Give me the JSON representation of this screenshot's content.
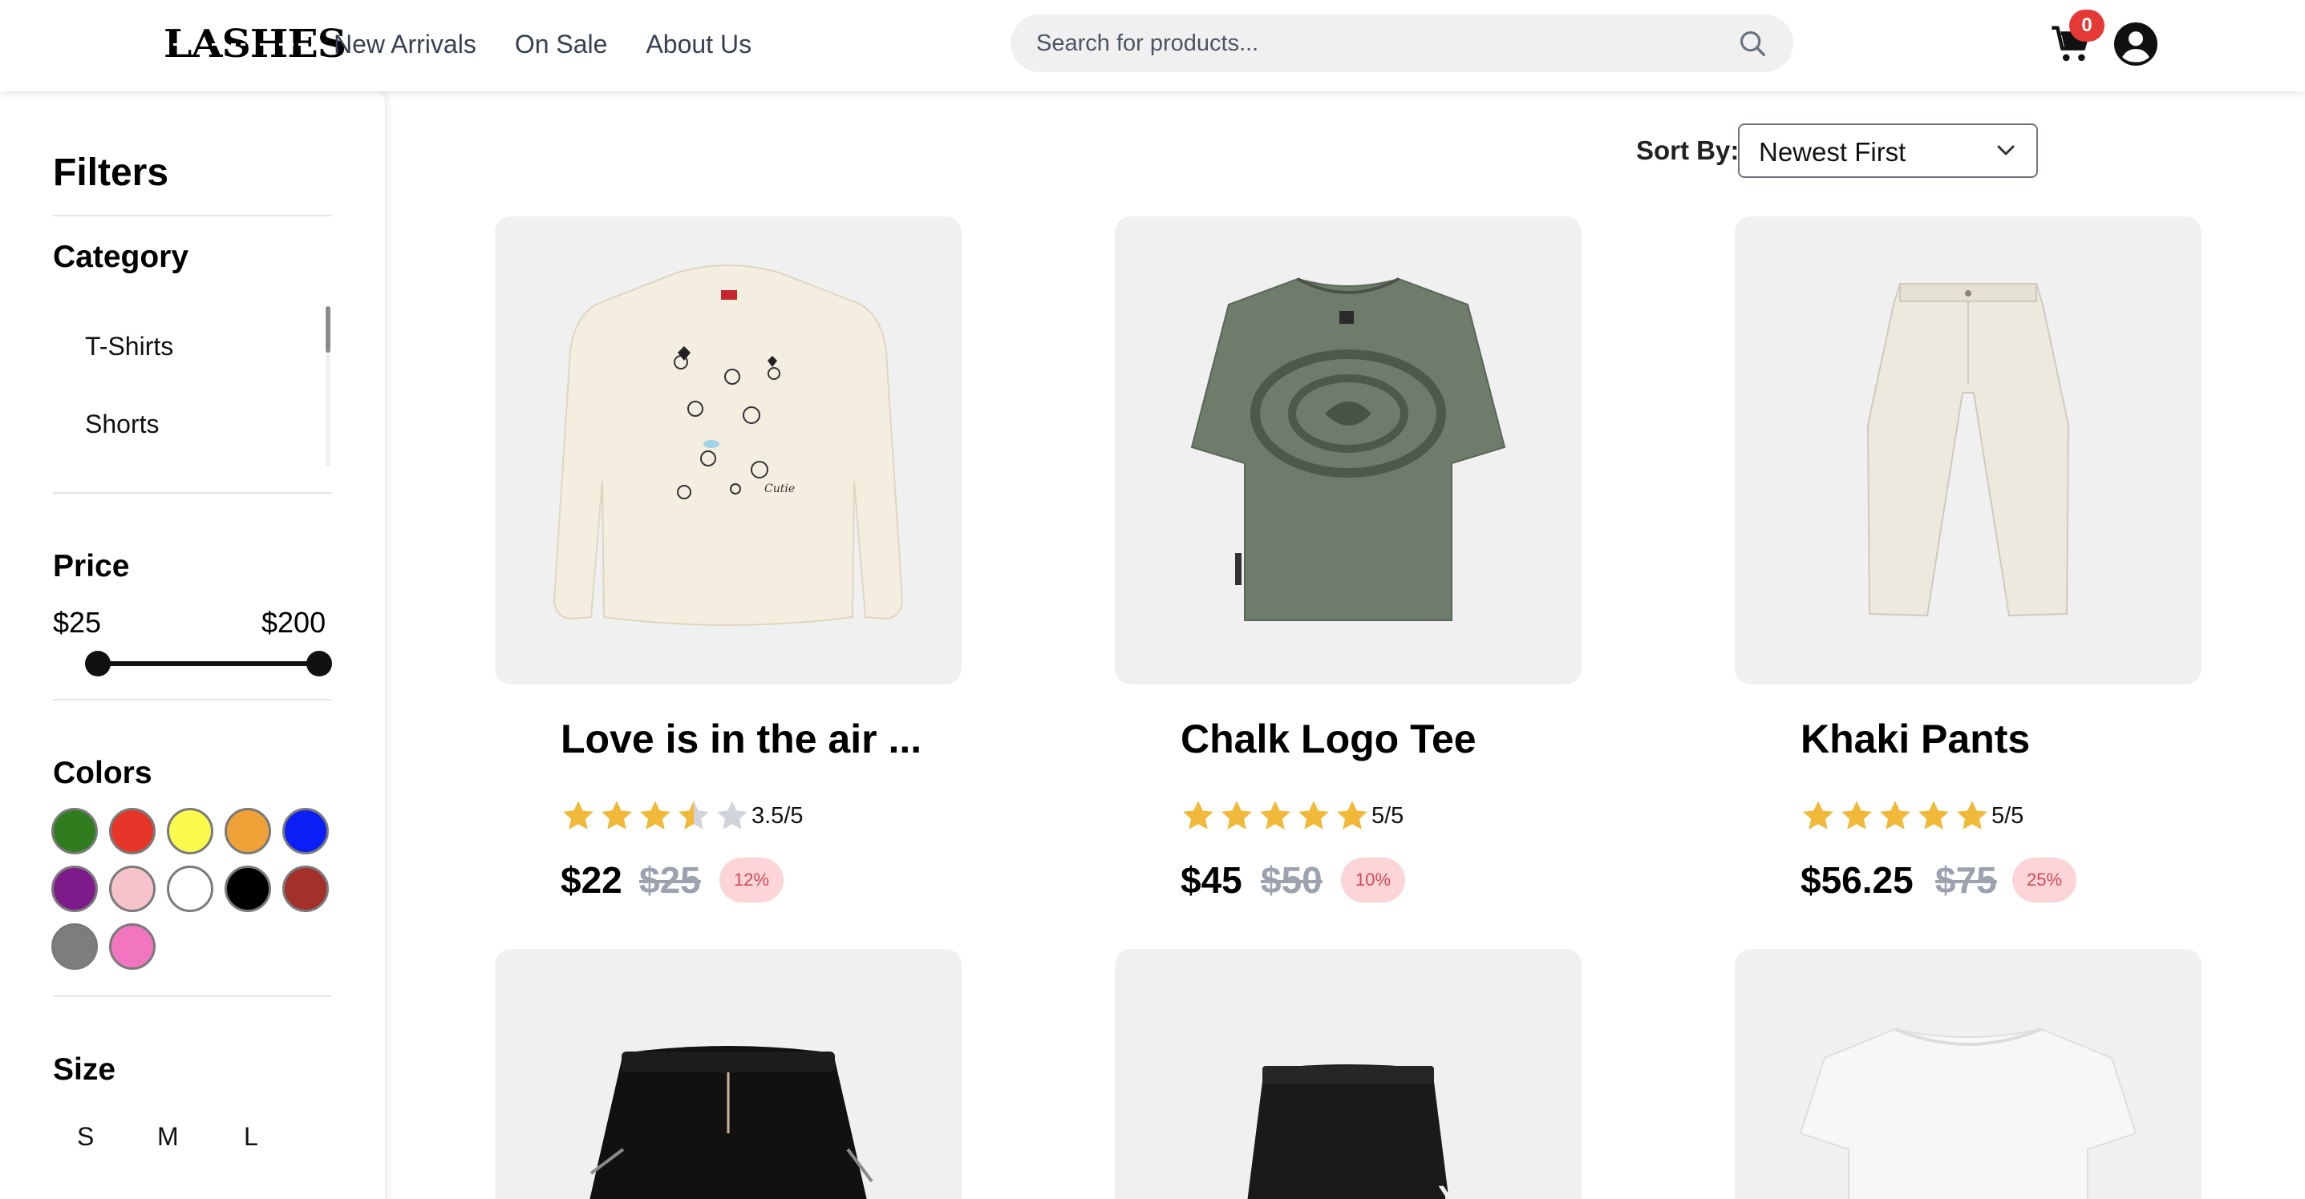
{
  "header": {
    "logo_text": "LASHES",
    "nav": [
      "New Arrivals",
      "On Sale",
      "About Us"
    ],
    "search_placeholder": "Search for products...",
    "cart_count": "0",
    "icons": {
      "search": "search-icon",
      "cart": "cart-icon",
      "user": "user-circle-icon"
    },
    "badge_color": "#e53935"
  },
  "sidebar": {
    "title": "Filters",
    "category_heading": "Category",
    "categories": [
      "T-Shirts",
      "Shorts"
    ],
    "price_heading": "Price",
    "price_min": "$25",
    "price_max": "$200",
    "colors_heading": "Colors",
    "colors": [
      "#2f7d1e",
      "#e8352a",
      "#fbfb4d",
      "#f0a236",
      "#0a1ef5",
      "#7e1a8a",
      "#f6c2cc",
      "#ffffff",
      "#000000",
      "#a3302a",
      "#7d7d7d",
      "#f276bf"
    ],
    "size_heading": "Size",
    "sizes": [
      "S",
      "M",
      "L"
    ]
  },
  "sort": {
    "label": "Sort By:",
    "value": "Newest First"
  },
  "products": [
    {
      "title": "Love is in the air ...",
      "rating": "3.5/5",
      "stars": 3.5,
      "price": "$22",
      "old_price": "$25",
      "discount": "12%"
    },
    {
      "title": "Chalk Logo Tee",
      "rating": "5/5",
      "stars": 5,
      "price": "$45",
      "old_price": "$50",
      "discount": "10%"
    },
    {
      "title": "Khaki Pants",
      "rating": "5/5",
      "stars": 5,
      "price": "$56.25",
      "old_price": "$75",
      "discount": "25%"
    }
  ],
  "star_color": "#f0b93a",
  "star_empty_color": "#d1d5db"
}
